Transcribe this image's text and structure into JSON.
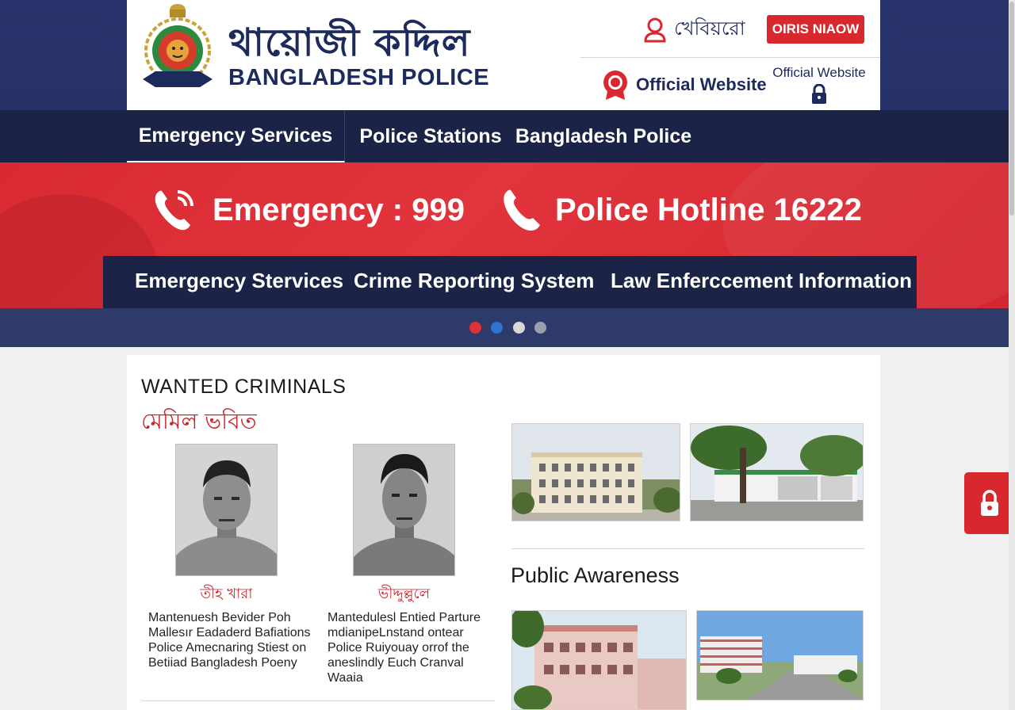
{
  "header": {
    "title_bn": "থায়োজী কদ্দিল",
    "title_en": "BANGLADESH POLICE",
    "emblem_text": "BANGLADESH POLICE",
    "login_label": "খেবিয়রো",
    "report_button": "OIRIS NIAOW",
    "official_link": "Official Website",
    "official_small": "Official Website"
  },
  "nav": {
    "items": [
      {
        "label": "Emergency Services"
      },
      {
        "label": "Police Stations"
      },
      {
        "label": "Bangladesh Police"
      }
    ]
  },
  "hero": {
    "emergency": "Emergency : 999",
    "hotline": "Police Hotline 16222",
    "sub_items": [
      {
        "label": "Emergency Stervices"
      },
      {
        "label": "Crime Reporting System"
      },
      {
        "label": "Law Enferccement Information"
      }
    ],
    "slider_dots": [
      {
        "color": "#e03038"
      },
      {
        "color": "#2f72d0"
      },
      {
        "color": "#d8d8d8"
      },
      {
        "color": "#9aa0ad"
      }
    ]
  },
  "wanted": {
    "title": "WANTED CRIMINALS",
    "subtitle_bn": "মেমিল ভবিত",
    "criminals": [
      {
        "name": "তীহ খারা",
        "desc_lines": [
          "Mantenuesh Bevider Poh",
          "Mallesır Eadaderd Bafiations",
          "Police Amecnaring Stiest on",
          "Betiiad Bangladesh Poeny"
        ]
      },
      {
        "name": "ভীদ্দুল্লুলে",
        "desc_lines": [
          "Mantedulesl Entied Parture",
          "mdianipeLnstand ontear",
          "Police Ruiyouay orrof the",
          "aneslindly Euch Cranval",
          "Waaia"
        ]
      }
    ]
  },
  "public_awareness": {
    "title": "Public Awareness"
  },
  "colors": {
    "navy": "#1b2446",
    "band": "#27336a",
    "red": "#d8282e",
    "white": "#ffffff"
  },
  "icons": {
    "user": "user-icon",
    "lock": "lock-icon",
    "phone": "phone-icon",
    "badge": "badge-icon"
  }
}
